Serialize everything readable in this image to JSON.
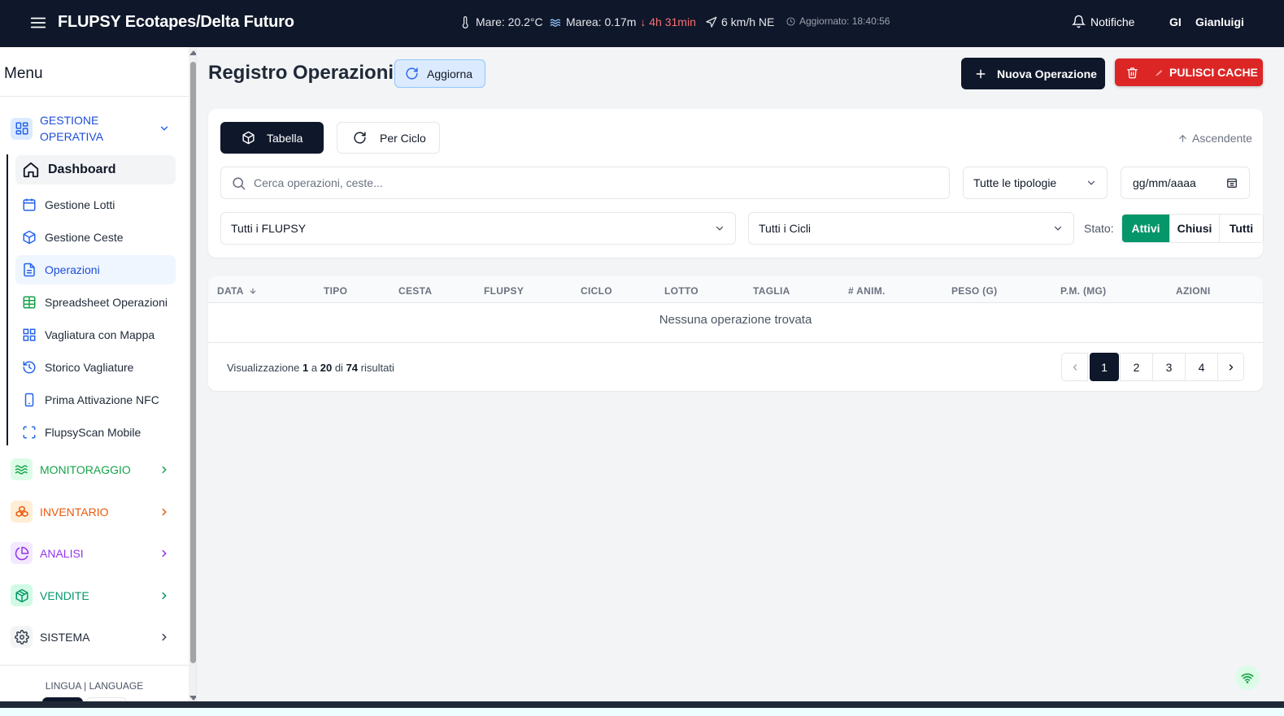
{
  "header": {
    "app_title": "FLUPSY Ecotapes/Delta Futuro",
    "sea_temp": "Mare: 20.2°C",
    "tide": "Marea: 0.17m",
    "tide_change": "↓ 4h 31min",
    "wind": "6 km/h NE",
    "updated": "Aggiornato: 18:40:56",
    "notifications": "Notifiche",
    "user_initials": "GI",
    "user_name": "Gianluigi"
  },
  "sidebar": {
    "menu_title": "Menu",
    "sections": {
      "gestione": "GESTIONE OPERATIVA",
      "monitoraggio": "MONITORAGGIO",
      "inventario": "INVENTARIO",
      "analisi": "ANALISI",
      "vendite": "VENDITE",
      "sistema": "SISTEMA"
    },
    "items": {
      "dashboard": "Dashboard",
      "lotti": "Gestione Lotti",
      "ceste": "Gestione Ceste",
      "operazioni": "Operazioni",
      "spreadsheet": "Spreadsheet Operazioni",
      "vagliatura": "Vagliatura con Mappa",
      "storico": "Storico Vagliature",
      "nfc": "Prima Attivazione NFC",
      "scan": "FlupsyScan Mobile"
    },
    "language_label": "LINGUA | LANGUAGE"
  },
  "main": {
    "title": "Registro Operazioni",
    "refresh": "Aggiorna",
    "new_operation": "Nuova Operazione",
    "clear_cache": "PULISCI CACHE",
    "view_table": "Tabella",
    "view_cycle": "Per Ciclo",
    "sort": "Ascendente",
    "search_placeholder": "Cerca operazioni, ceste...",
    "type_filter": "Tutte le tipologie",
    "date_placeholder": "gg/mm/aaaa",
    "flupsy_filter": "Tutti i FLUPSY",
    "cycle_filter": "Tutti i Cicli",
    "status_label": "Stato:",
    "status_options": [
      "Attivi",
      "Chiusi",
      "Tutti"
    ],
    "status_selected": "Attivi"
  },
  "table": {
    "columns": [
      "DATA",
      "TIPO",
      "CESTA",
      "FLUPSY",
      "CICLO",
      "LOTTO",
      "TAGLIA",
      "# ANIM.",
      "PESO (G)",
      "P.M. (MG)",
      "AZIONI"
    ],
    "empty_message": "Nessuna operazione trovata",
    "results": {
      "prefix": "Visualizzazione",
      "from": "1",
      "to": "20",
      "total": "74",
      "a": "a",
      "di": "di",
      "suffix": "risultati"
    },
    "pages": [
      "1",
      "2",
      "3",
      "4"
    ],
    "current_page": "1"
  },
  "colors": {
    "header_bg": "#0f172a",
    "accent_blue": "#1d4ed8",
    "danger": "#dc2626",
    "success": "#059669",
    "tide_down": "#f87171"
  }
}
